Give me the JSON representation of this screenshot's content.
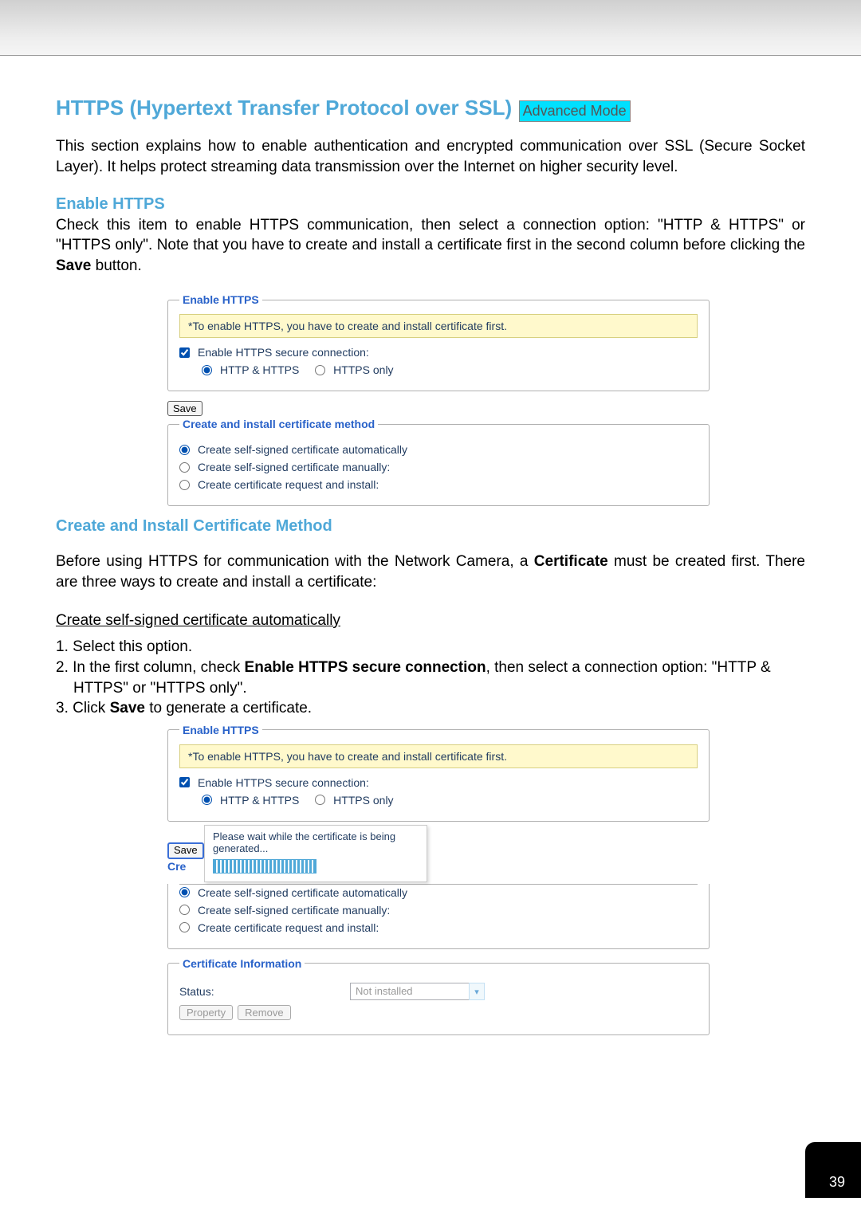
{
  "header": {
    "title": "HTTPS (Hypertext Transfer Protocol over SSL)",
    "badge": "Advanced Mode"
  },
  "intro": "This section explains how to enable authentication and encrypted communication over SSL (Secure Socket Layer). It helps protect streaming data transmission over the Internet on higher security level.",
  "section1": {
    "heading": "Enable HTTPS",
    "text_before_bold": "Check this item to enable HTTPS communication, then select a connection option: \"HTTP & HTTPS\" or \"HTTPS only\". Note that you have to create and install a certificate first in the second column before clicking the ",
    "bold": "Save",
    "text_after_bold": " button."
  },
  "ui1": {
    "fs1_legend": "Enable HTTPS",
    "note": "*To enable HTTPS, you have to create and install certificate first.",
    "cb_label": "Enable HTTPS secure connection:",
    "radio_a": "HTTP & HTTPS",
    "radio_b": "HTTPS only",
    "save": "Save",
    "fs2_legend": "Create and install certificate method",
    "r1": "Create self-signed certificate automatically",
    "r2": "Create self-signed certificate manually:",
    "r3": "Create certificate request and install:"
  },
  "section2": {
    "heading": "Create and Install Certificate Method",
    "p1_before": "Before using HTTPS for communication with the Network Camera, a ",
    "p1_bold": "Certificate",
    "p1_after": " must be created first. There are three ways to create and install a certificate:",
    "sub_underline": "Create self-signed certificate automatically",
    "li1": "1. Select this option.",
    "li2a": "2. In the first column, check ",
    "li2b": "Enable HTTPS secure connection",
    "li2c": ", then select a connection option: \"HTTP & HTTPS\" or \"HTTPS only\".",
    "li3a": "3. Click ",
    "li3b": "Save",
    "li3c": " to generate a certificate."
  },
  "ui2": {
    "fs1_legend": "Enable HTTPS",
    "note": "*To enable HTTPS, you have to create and install certificate first.",
    "cb_label": "Enable HTTPS secure connection:",
    "radio_a": "HTTP & HTTPS",
    "radio_b": "HTTPS only",
    "save": "Save",
    "progress_msg": "Please wait while the certificate is being generated...",
    "fs2_partial": "Cre",
    "r1": "Create self-signed certificate automatically",
    "r2": "Create self-signed certificate manually:",
    "r3": "Create certificate request and install:",
    "fs3_legend": "Certificate Information",
    "status_label": "Status:",
    "status_value": "Not installed",
    "btn_prop": "Property",
    "btn_remove": "Remove"
  },
  "page_number": "39"
}
